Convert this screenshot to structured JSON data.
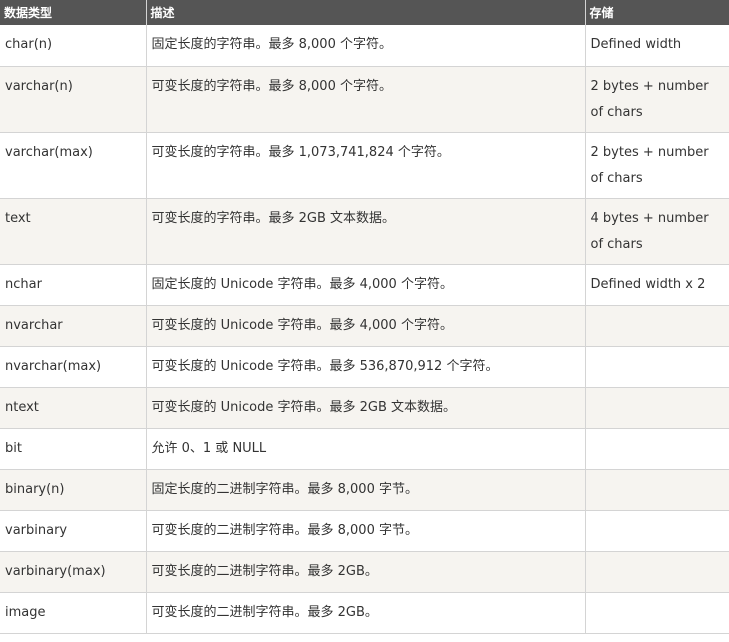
{
  "table": {
    "headers": [
      "数据类型",
      "描述",
      "存储"
    ],
    "rows": [
      {
        "type": "char(n)",
        "desc": "固定长度的字符串。最多 8,000 个字符。",
        "storage": "Defined width"
      },
      {
        "type": "varchar(n)",
        "desc": "可变长度的字符串。最多 8,000 个字符。",
        "storage": "2 bytes + number of chars"
      },
      {
        "type": "varchar(max)",
        "desc": "可变长度的字符串。最多 1,073,741,824 个字符。",
        "storage": "2 bytes + number of chars"
      },
      {
        "type": "text",
        "desc": "可变长度的字符串。最多 2GB 文本数据。",
        "storage": "4 bytes + number of chars"
      },
      {
        "type": "nchar",
        "desc": "固定长度的 Unicode 字符串。最多 4,000 个字符。",
        "storage": "Defined width x 2"
      },
      {
        "type": "nvarchar",
        "desc": "可变长度的 Unicode 字符串。最多 4,000 个字符。",
        "storage": ""
      },
      {
        "type": "nvarchar(max)",
        "desc": "可变长度的 Unicode 字符串。最多 536,870,912 个字符。",
        "storage": ""
      },
      {
        "type": "ntext",
        "desc": "可变长度的 Unicode 字符串。最多 2GB 文本数据。",
        "storage": ""
      },
      {
        "type": "bit",
        "desc": "允许 0、1 或 NULL",
        "storage": ""
      },
      {
        "type": "binary(n)",
        "desc": "固定长度的二进制字符串。最多 8,000 字节。",
        "storage": ""
      },
      {
        "type": "varbinary",
        "desc": "可变长度的二进制字符串。最多 8,000 字节。",
        "storage": ""
      },
      {
        "type": "varbinary(max)",
        "desc": "可变长度的二进制字符串。最多 2GB。",
        "storage": ""
      },
      {
        "type": "image",
        "desc": "可变长度的二进制字符串。最多 2GB。",
        "storage": ""
      }
    ]
  }
}
